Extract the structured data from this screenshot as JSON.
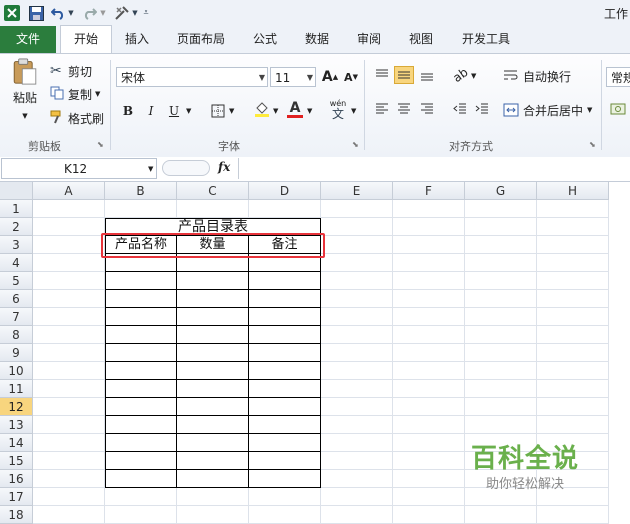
{
  "quick_access": {
    "title": "工作"
  },
  "tabs": [
    {
      "label": "文件"
    },
    {
      "label": "开始"
    },
    {
      "label": "插入"
    },
    {
      "label": "页面布局"
    },
    {
      "label": "公式"
    },
    {
      "label": "数据"
    },
    {
      "label": "审阅"
    },
    {
      "label": "视图"
    },
    {
      "label": "开发工具"
    }
  ],
  "ribbon": {
    "clipboard": {
      "paste_label": "粘贴",
      "cut_label": "剪切",
      "copy_label": "复制",
      "format_painter_label": "格式刷",
      "group_label": "剪贴板"
    },
    "font": {
      "font_name": "宋体",
      "font_size": "11",
      "bold": "B",
      "italic": "I",
      "underline": "U",
      "font_color_letter": "A",
      "grow_letter": "A",
      "shrink_letter": "A",
      "phonetic_top": "wén",
      "phonetic_bottom": "文",
      "group_label": "字体"
    },
    "alignment": {
      "wrap_text_label": "自动换行",
      "merge_center_label": "合并后居中",
      "group_label": "对齐方式"
    },
    "number": {
      "format_label": "常规"
    }
  },
  "formula_bar": {
    "name_box": "K12",
    "fx": "fx",
    "value": ""
  },
  "columns": [
    "A",
    "B",
    "C",
    "D",
    "E",
    "F",
    "G",
    "H"
  ],
  "rows": [
    "1",
    "2",
    "3",
    "4",
    "5",
    "6",
    "7",
    "8",
    "9",
    "10",
    "11",
    "12",
    "13",
    "14",
    "15",
    "16",
    "17",
    "18"
  ],
  "selected_row": "12",
  "table": {
    "title": "产品目录表",
    "headers": [
      "产品名称",
      "数量",
      "备注"
    ]
  },
  "watermark": {
    "brand": "百科全说",
    "tagline": "助你轻松解决"
  },
  "colors": {
    "file_tab": "#2b7d3d",
    "highlight_box": "#e8343b",
    "selected_row_header": "#f8d57e",
    "watermark_green": "#6ab04c"
  }
}
